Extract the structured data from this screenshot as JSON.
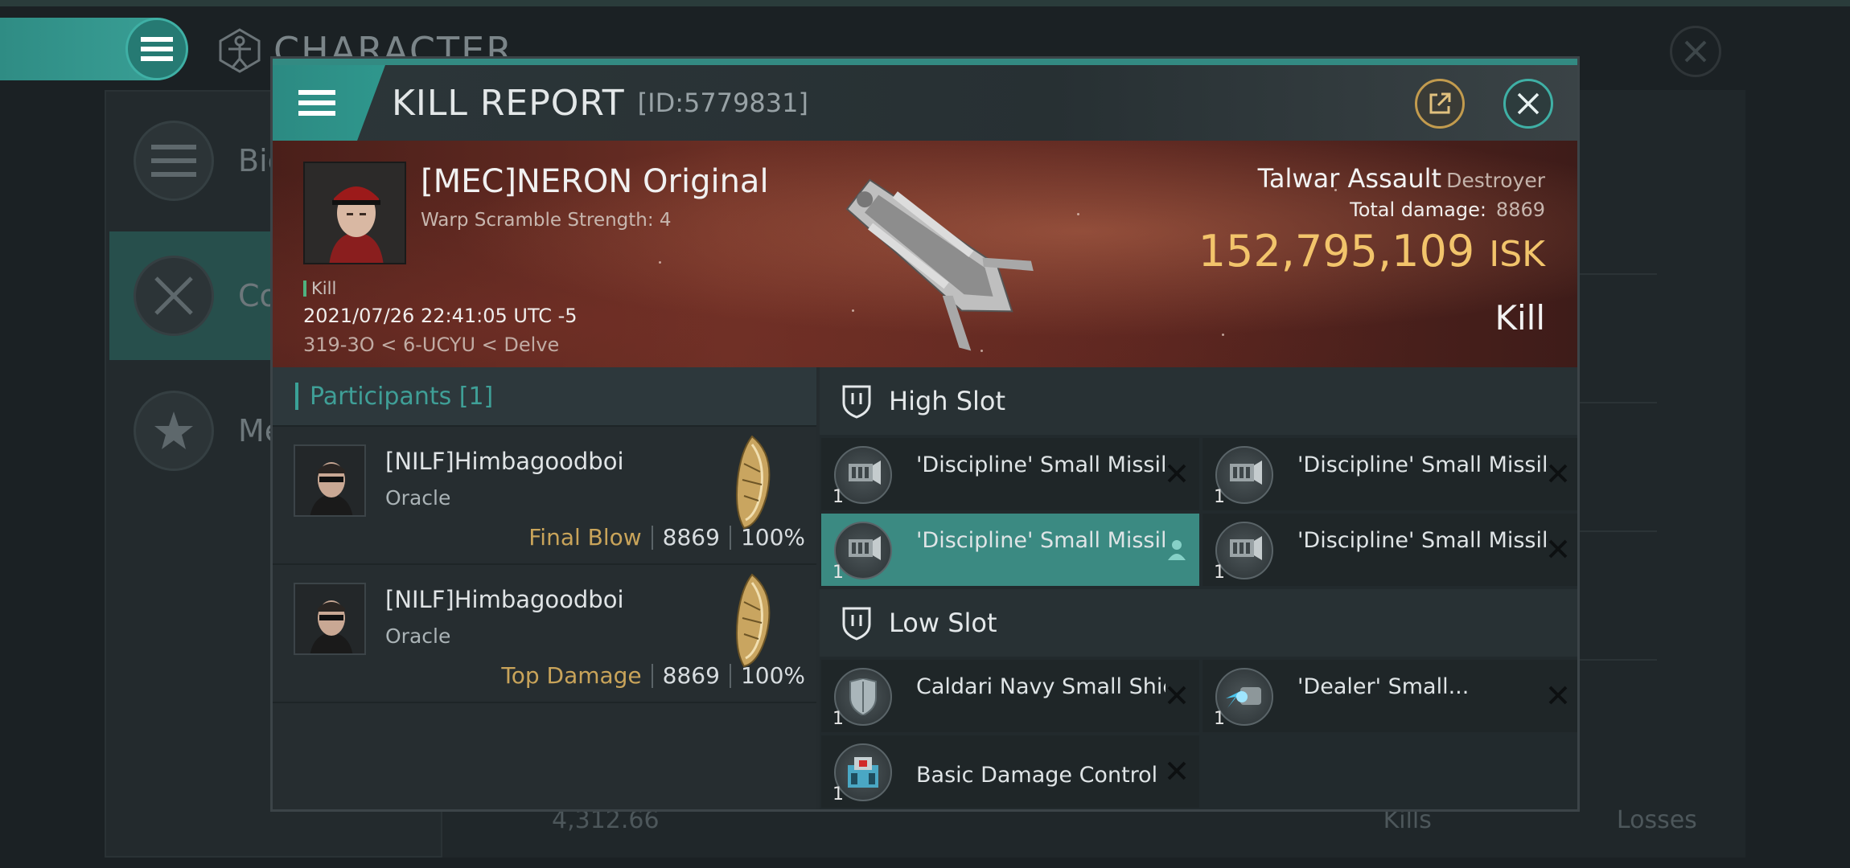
{
  "background": {
    "title": "CHARACTER",
    "nav": [
      {
        "label": "Bio"
      },
      {
        "label": "Co"
      },
      {
        "label": "Me"
      }
    ],
    "bottom": {
      "value": "4,312.66",
      "kills_label": "Kills",
      "losses_label": "Losses"
    }
  },
  "header": {
    "title": "KILL REPORT",
    "id": "[ID:5779831]"
  },
  "victim": {
    "name": "[MEC]NERON Original",
    "warp_scramble": "Warp Scramble Strength: 4",
    "tag": "Kill",
    "time": "2021/07/26 22:41:05 UTC -5",
    "location": "319-3O < 6-UCYU < Delve",
    "ship_name": "Talwar Assault",
    "ship_class": "Destroyer",
    "total_damage_label": "Total damage:",
    "total_damage": "8869",
    "isk_value": "152,795,109",
    "isk_unit": "ISK",
    "result": "Kill"
  },
  "participants": {
    "header": "Participants [1]",
    "rows": [
      {
        "name": "[NILF]Himbagoodboi",
        "ship": "Oracle",
        "tag": "Final Blow",
        "damage": "8869",
        "percent": "100%"
      },
      {
        "name": "[NILF]Himbagoodboi",
        "ship": "Oracle",
        "tag": "Top Damage",
        "damage": "8869",
        "percent": "100%"
      }
    ]
  },
  "slots": {
    "high": {
      "label": "High Slot",
      "items": [
        {
          "name": "'Discipline' Small Missile...",
          "qty": "1",
          "icon": "missile-launcher-icon"
        },
        {
          "name": "'Discipline' Small Missile...",
          "qty": "1",
          "icon": "missile-launcher-icon"
        },
        {
          "name": "'Discipline' Small Missile...",
          "qty": "1",
          "icon": "missile-launcher-icon"
        },
        {
          "name": "'Discipline' Small Missile...",
          "qty": "1",
          "icon": "missile-launcher-icon"
        }
      ]
    },
    "low": {
      "label": "Low Slot",
      "items": [
        {
          "name": "Caldari Navy Small Shield...",
          "qty": "1",
          "icon": "shield-module-icon"
        },
        {
          "name": "'Dealer' Small...",
          "qty": "1",
          "icon": "weapon-upgrade-icon"
        },
        {
          "name": "Basic Damage Control",
          "qty": "1",
          "icon": "damage-control-icon"
        }
      ]
    }
  },
  "colors": {
    "accent": "#3aa197",
    "isk_gold": "#f2c46b",
    "tag_gold": "#c9a45a",
    "banner_red": "#6a2e24"
  }
}
